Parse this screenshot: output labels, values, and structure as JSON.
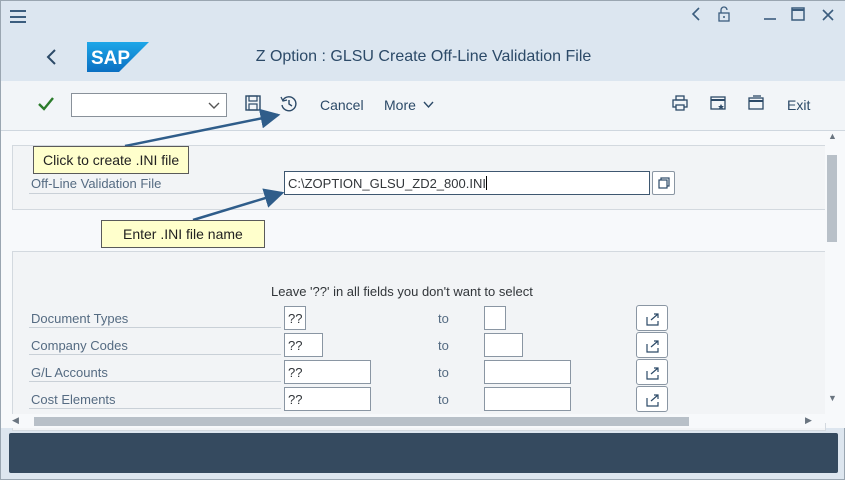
{
  "window": {
    "controls": [
      "back-arrow-icon",
      "lock-icon",
      "minimize-icon",
      "maximize-icon",
      "close-icon"
    ]
  },
  "header": {
    "logo_text": "SAP",
    "title": "Z Option : GLSU Create Off-Line Validation File"
  },
  "toolbar": {
    "command_value": "",
    "cancel_label": "Cancel",
    "more_label": "More",
    "exit_label": "Exit"
  },
  "form": {
    "file_label": "Off-Line Validation File",
    "file_value": "C:\\ZOPTION_GLSU_ZD2_800.INI"
  },
  "selection": {
    "hint": "Leave '??' in all fields you don't want to select",
    "rows": [
      {
        "label": "Document Types",
        "from": "??",
        "to_label": "to",
        "to": ""
      },
      {
        "label": "Company Codes",
        "from": "??",
        "to_label": "to",
        "to": ""
      },
      {
        "label": "G/L Accounts",
        "from": "??",
        "to_label": "to",
        "to": ""
      },
      {
        "label": "Cost Elements",
        "from": "??",
        "to_label": "to",
        "to": ""
      }
    ]
  },
  "annotations": {
    "create_ini": "Click to create .INI file",
    "enter_name": "Enter .INI file name"
  },
  "colors": {
    "header_bg": "#dce6f0",
    "toolbar_bg": "#f2f5f8",
    "callout_bg": "#ffffcc",
    "status_bar": "#354a5f",
    "arrow": "#2f5d8a",
    "check": "#2b7c2b"
  }
}
